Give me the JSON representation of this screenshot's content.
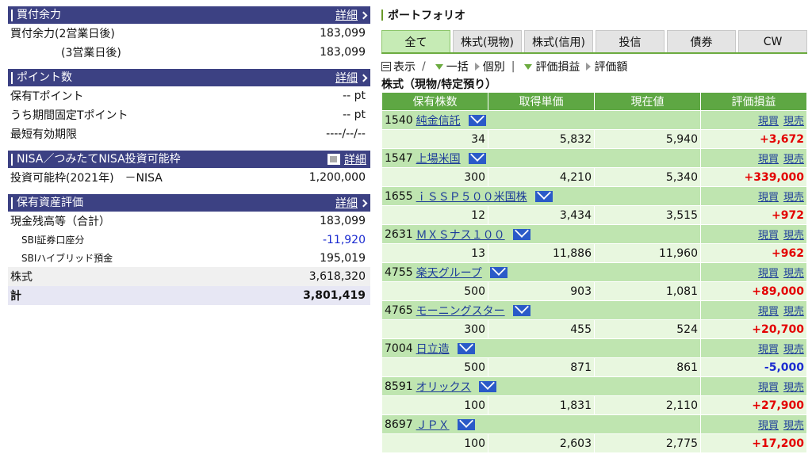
{
  "buying_power": {
    "title": "買付余力",
    "detail": "詳細",
    "rows": [
      {
        "label": "買付余力(2営業日後)",
        "value": "183,099"
      },
      {
        "label": "(3営業日後)",
        "value": "183,099"
      }
    ]
  },
  "points": {
    "title": "ポイント数",
    "detail": "詳細",
    "rows": [
      {
        "label": "保有Tポイント",
        "value": "-- pt"
      },
      {
        "label": "うち期間固定Tポイント",
        "value": "-- pt"
      },
      {
        "label": "最短有効期限",
        "value": "----/--/--"
      }
    ]
  },
  "nisa": {
    "title": "NISA／つみたてNISA投資可能枠",
    "detail": "詳細",
    "rows": [
      {
        "label": "投資可能枠(2021年)　－NISA",
        "value": "1,200,000"
      }
    ]
  },
  "assets": {
    "title": "保有資産評価",
    "detail": "詳細",
    "cash_label": "現金残高等（合計）",
    "cash_value": "183,099",
    "sbi_label": "SBI証券口座分",
    "sbi_value": "-11,920",
    "hybrid_label": "SBIハイブリッド預金",
    "hybrid_value": "195,019",
    "stock_label": "株式",
    "stock_value": "3,618,320",
    "total_label": "計",
    "total_value": "3,801,419"
  },
  "portfolio": {
    "title": "ポートフォリオ",
    "tabs": [
      "全て",
      "株式(現物)",
      "株式(信用)",
      "投信",
      "債券",
      "CW"
    ],
    "view": {
      "show": "表示",
      "slash": "/",
      "all": "一括",
      "each": "個別",
      "pl": "評価損益",
      "value": "評価額"
    },
    "subtitle": "株式（現物/特定預り）",
    "columns": [
      "保有株数",
      "取得単価",
      "現在値",
      "評価損益"
    ],
    "buy_label": "現買",
    "sell_label": "現売",
    "holdings": [
      {
        "code": "1540",
        "name": "純金信託",
        "qty": "34",
        "cost": "5,832",
        "price": "5,940",
        "pl": "+3,672"
      },
      {
        "code": "1547",
        "name": "上場米国",
        "qty": "300",
        "cost": "4,210",
        "price": "5,340",
        "pl": "+339,000"
      },
      {
        "code": "1655",
        "name": "ｉＳＳＰ５００米国株",
        "qty": "12",
        "cost": "3,434",
        "price": "3,515",
        "pl": "+972"
      },
      {
        "code": "2631",
        "name": "ＭＸＳナス１００",
        "qty": "13",
        "cost": "11,886",
        "price": "11,960",
        "pl": "+962"
      },
      {
        "code": "4755",
        "name": "楽天グループ",
        "qty": "500",
        "cost": "903",
        "price": "1,081",
        "pl": "+89,000"
      },
      {
        "code": "4765",
        "name": "モーニングスター",
        "qty": "300",
        "cost": "455",
        "price": "524",
        "pl": "+20,700"
      },
      {
        "code": "7004",
        "name": "日立造",
        "qty": "500",
        "cost": "871",
        "price": "861",
        "pl": "-5,000"
      },
      {
        "code": "8591",
        "name": "オリックス",
        "qty": "100",
        "cost": "1,831",
        "price": "2,110",
        "pl": "+27,900"
      },
      {
        "code": "8697",
        "name": "ＪＰＸ",
        "qty": "100",
        "cost": "2,603",
        "price": "2,775",
        "pl": "+17,200"
      }
    ]
  }
}
